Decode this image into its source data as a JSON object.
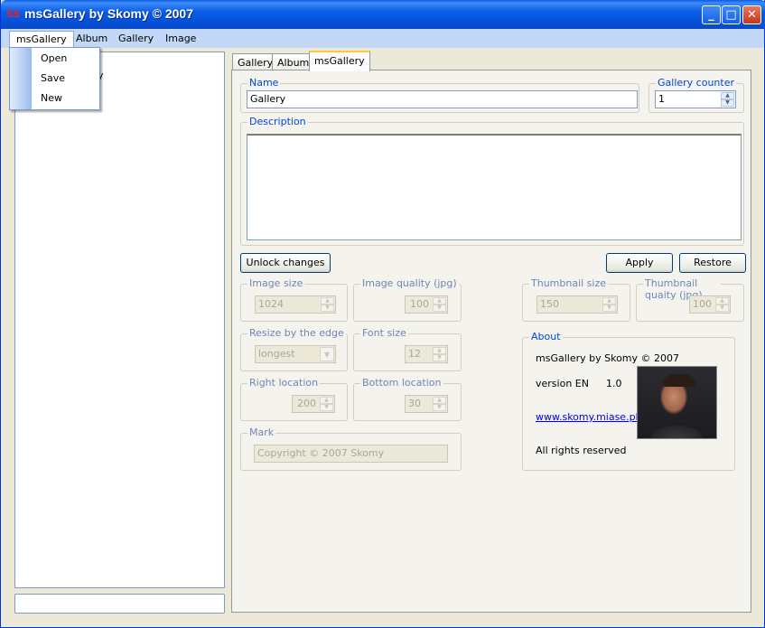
{
  "window": {
    "title": "msGallery by Skomy © 2007",
    "app_icon_glyph": "SS",
    "minimize_glyph": "_",
    "maximize_glyph": "□",
    "close_glyph": "✕"
  },
  "menubar": {
    "items": [
      "msGallery",
      "Album",
      "Gallery",
      "Image"
    ]
  },
  "dropdown": {
    "items": [
      "Open",
      "Save",
      "New"
    ]
  },
  "left_panel": {
    "tree_fragment": "y"
  },
  "tabs": [
    "Gallery",
    "Album",
    "msGallery"
  ],
  "form": {
    "name_label": "Name",
    "name_value": "Gallery",
    "gallery_counter_label": "Gallery counter",
    "gallery_counter_value": "1",
    "description_label": "Description",
    "unlock_button": "Unlock changes",
    "apply_button": "Apply",
    "restore_button": "Restore",
    "image_size_label": "Image size",
    "image_size_value": "1024",
    "image_quality_label": "Image quality (jpg)",
    "image_quality_value": "100",
    "thumbnail_size_label": "Thumbnail size",
    "thumbnail_size_value": "150",
    "thumbnail_quality_label": "Thumbnail quaity (jpg)",
    "thumbnail_quality_value": "100",
    "resize_edge_label": "Resize by the edge",
    "resize_edge_value": "longest",
    "font_size_label": "Font size",
    "font_size_value": "12",
    "right_location_label": "Right location",
    "right_location_value": "200",
    "bottom_location_label": "Bottom location",
    "bottom_location_value": "30",
    "mark_label": "Mark",
    "mark_value": "Copyright © 2007 Skomy"
  },
  "about": {
    "label": "About",
    "line1": "msGallery by Skomy © 2007",
    "version_label": "version EN",
    "version_value": "1.0",
    "link": "www.skomy.miase.pl",
    "rights": "All rights reserved"
  },
  "colors": {
    "titlebar": "#0a5ae8",
    "menubar": "#c2d8f6",
    "group_label": "#0046d5",
    "tab_highlight": "#ffc83c"
  }
}
